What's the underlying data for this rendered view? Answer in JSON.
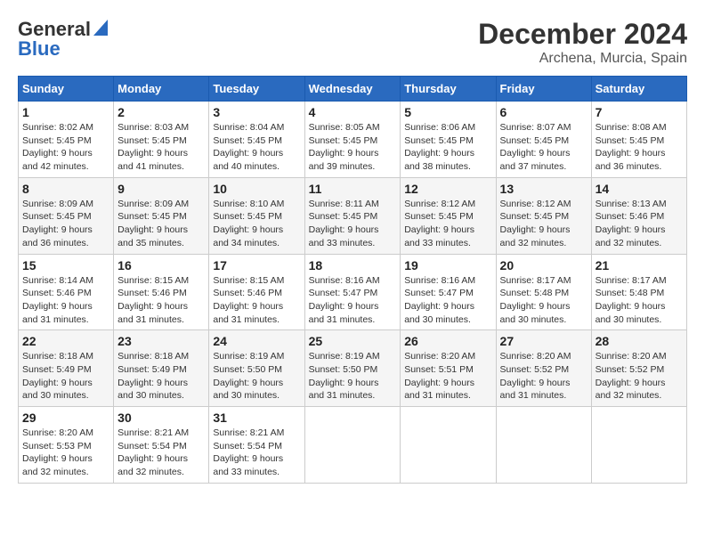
{
  "header": {
    "logo_line1": "General",
    "logo_line2": "Blue",
    "month": "December 2024",
    "location": "Archena, Murcia, Spain"
  },
  "weekdays": [
    "Sunday",
    "Monday",
    "Tuesday",
    "Wednesday",
    "Thursday",
    "Friday",
    "Saturday"
  ],
  "weeks": [
    [
      {
        "day": "1",
        "sunrise": "Sunrise: 8:02 AM",
        "sunset": "Sunset: 5:45 PM",
        "daylight": "Daylight: 9 hours and 42 minutes."
      },
      {
        "day": "2",
        "sunrise": "Sunrise: 8:03 AM",
        "sunset": "Sunset: 5:45 PM",
        "daylight": "Daylight: 9 hours and 41 minutes."
      },
      {
        "day": "3",
        "sunrise": "Sunrise: 8:04 AM",
        "sunset": "Sunset: 5:45 PM",
        "daylight": "Daylight: 9 hours and 40 minutes."
      },
      {
        "day": "4",
        "sunrise": "Sunrise: 8:05 AM",
        "sunset": "Sunset: 5:45 PM",
        "daylight": "Daylight: 9 hours and 39 minutes."
      },
      {
        "day": "5",
        "sunrise": "Sunrise: 8:06 AM",
        "sunset": "Sunset: 5:45 PM",
        "daylight": "Daylight: 9 hours and 38 minutes."
      },
      {
        "day": "6",
        "sunrise": "Sunrise: 8:07 AM",
        "sunset": "Sunset: 5:45 PM",
        "daylight": "Daylight: 9 hours and 37 minutes."
      },
      {
        "day": "7",
        "sunrise": "Sunrise: 8:08 AM",
        "sunset": "Sunset: 5:45 PM",
        "daylight": "Daylight: 9 hours and 36 minutes."
      }
    ],
    [
      {
        "day": "8",
        "sunrise": "Sunrise: 8:09 AM",
        "sunset": "Sunset: 5:45 PM",
        "daylight": "Daylight: 9 hours and 36 minutes."
      },
      {
        "day": "9",
        "sunrise": "Sunrise: 8:09 AM",
        "sunset": "Sunset: 5:45 PM",
        "daylight": "Daylight: 9 hours and 35 minutes."
      },
      {
        "day": "10",
        "sunrise": "Sunrise: 8:10 AM",
        "sunset": "Sunset: 5:45 PM",
        "daylight": "Daylight: 9 hours and 34 minutes."
      },
      {
        "day": "11",
        "sunrise": "Sunrise: 8:11 AM",
        "sunset": "Sunset: 5:45 PM",
        "daylight": "Daylight: 9 hours and 33 minutes."
      },
      {
        "day": "12",
        "sunrise": "Sunrise: 8:12 AM",
        "sunset": "Sunset: 5:45 PM",
        "daylight": "Daylight: 9 hours and 33 minutes."
      },
      {
        "day": "13",
        "sunrise": "Sunrise: 8:12 AM",
        "sunset": "Sunset: 5:45 PM",
        "daylight": "Daylight: 9 hours and 32 minutes."
      },
      {
        "day": "14",
        "sunrise": "Sunrise: 8:13 AM",
        "sunset": "Sunset: 5:46 PM",
        "daylight": "Daylight: 9 hours and 32 minutes."
      }
    ],
    [
      {
        "day": "15",
        "sunrise": "Sunrise: 8:14 AM",
        "sunset": "Sunset: 5:46 PM",
        "daylight": "Daylight: 9 hours and 31 minutes."
      },
      {
        "day": "16",
        "sunrise": "Sunrise: 8:15 AM",
        "sunset": "Sunset: 5:46 PM",
        "daylight": "Daylight: 9 hours and 31 minutes."
      },
      {
        "day": "17",
        "sunrise": "Sunrise: 8:15 AM",
        "sunset": "Sunset: 5:46 PM",
        "daylight": "Daylight: 9 hours and 31 minutes."
      },
      {
        "day": "18",
        "sunrise": "Sunrise: 8:16 AM",
        "sunset": "Sunset: 5:47 PM",
        "daylight": "Daylight: 9 hours and 31 minutes."
      },
      {
        "day": "19",
        "sunrise": "Sunrise: 8:16 AM",
        "sunset": "Sunset: 5:47 PM",
        "daylight": "Daylight: 9 hours and 30 minutes."
      },
      {
        "day": "20",
        "sunrise": "Sunrise: 8:17 AM",
        "sunset": "Sunset: 5:48 PM",
        "daylight": "Daylight: 9 hours and 30 minutes."
      },
      {
        "day": "21",
        "sunrise": "Sunrise: 8:17 AM",
        "sunset": "Sunset: 5:48 PM",
        "daylight": "Daylight: 9 hours and 30 minutes."
      }
    ],
    [
      {
        "day": "22",
        "sunrise": "Sunrise: 8:18 AM",
        "sunset": "Sunset: 5:49 PM",
        "daylight": "Daylight: 9 hours and 30 minutes."
      },
      {
        "day": "23",
        "sunrise": "Sunrise: 8:18 AM",
        "sunset": "Sunset: 5:49 PM",
        "daylight": "Daylight: 9 hours and 30 minutes."
      },
      {
        "day": "24",
        "sunrise": "Sunrise: 8:19 AM",
        "sunset": "Sunset: 5:50 PM",
        "daylight": "Daylight: 9 hours and 30 minutes."
      },
      {
        "day": "25",
        "sunrise": "Sunrise: 8:19 AM",
        "sunset": "Sunset: 5:50 PM",
        "daylight": "Daylight: 9 hours and 31 minutes."
      },
      {
        "day": "26",
        "sunrise": "Sunrise: 8:20 AM",
        "sunset": "Sunset: 5:51 PM",
        "daylight": "Daylight: 9 hours and 31 minutes."
      },
      {
        "day": "27",
        "sunrise": "Sunrise: 8:20 AM",
        "sunset": "Sunset: 5:52 PM",
        "daylight": "Daylight: 9 hours and 31 minutes."
      },
      {
        "day": "28",
        "sunrise": "Sunrise: 8:20 AM",
        "sunset": "Sunset: 5:52 PM",
        "daylight": "Daylight: 9 hours and 32 minutes."
      }
    ],
    [
      {
        "day": "29",
        "sunrise": "Sunrise: 8:20 AM",
        "sunset": "Sunset: 5:53 PM",
        "daylight": "Daylight: 9 hours and 32 minutes."
      },
      {
        "day": "30",
        "sunrise": "Sunrise: 8:21 AM",
        "sunset": "Sunset: 5:54 PM",
        "daylight": "Daylight: 9 hours and 32 minutes."
      },
      {
        "day": "31",
        "sunrise": "Sunrise: 8:21 AM",
        "sunset": "Sunset: 5:54 PM",
        "daylight": "Daylight: 9 hours and 33 minutes."
      },
      null,
      null,
      null,
      null
    ]
  ]
}
